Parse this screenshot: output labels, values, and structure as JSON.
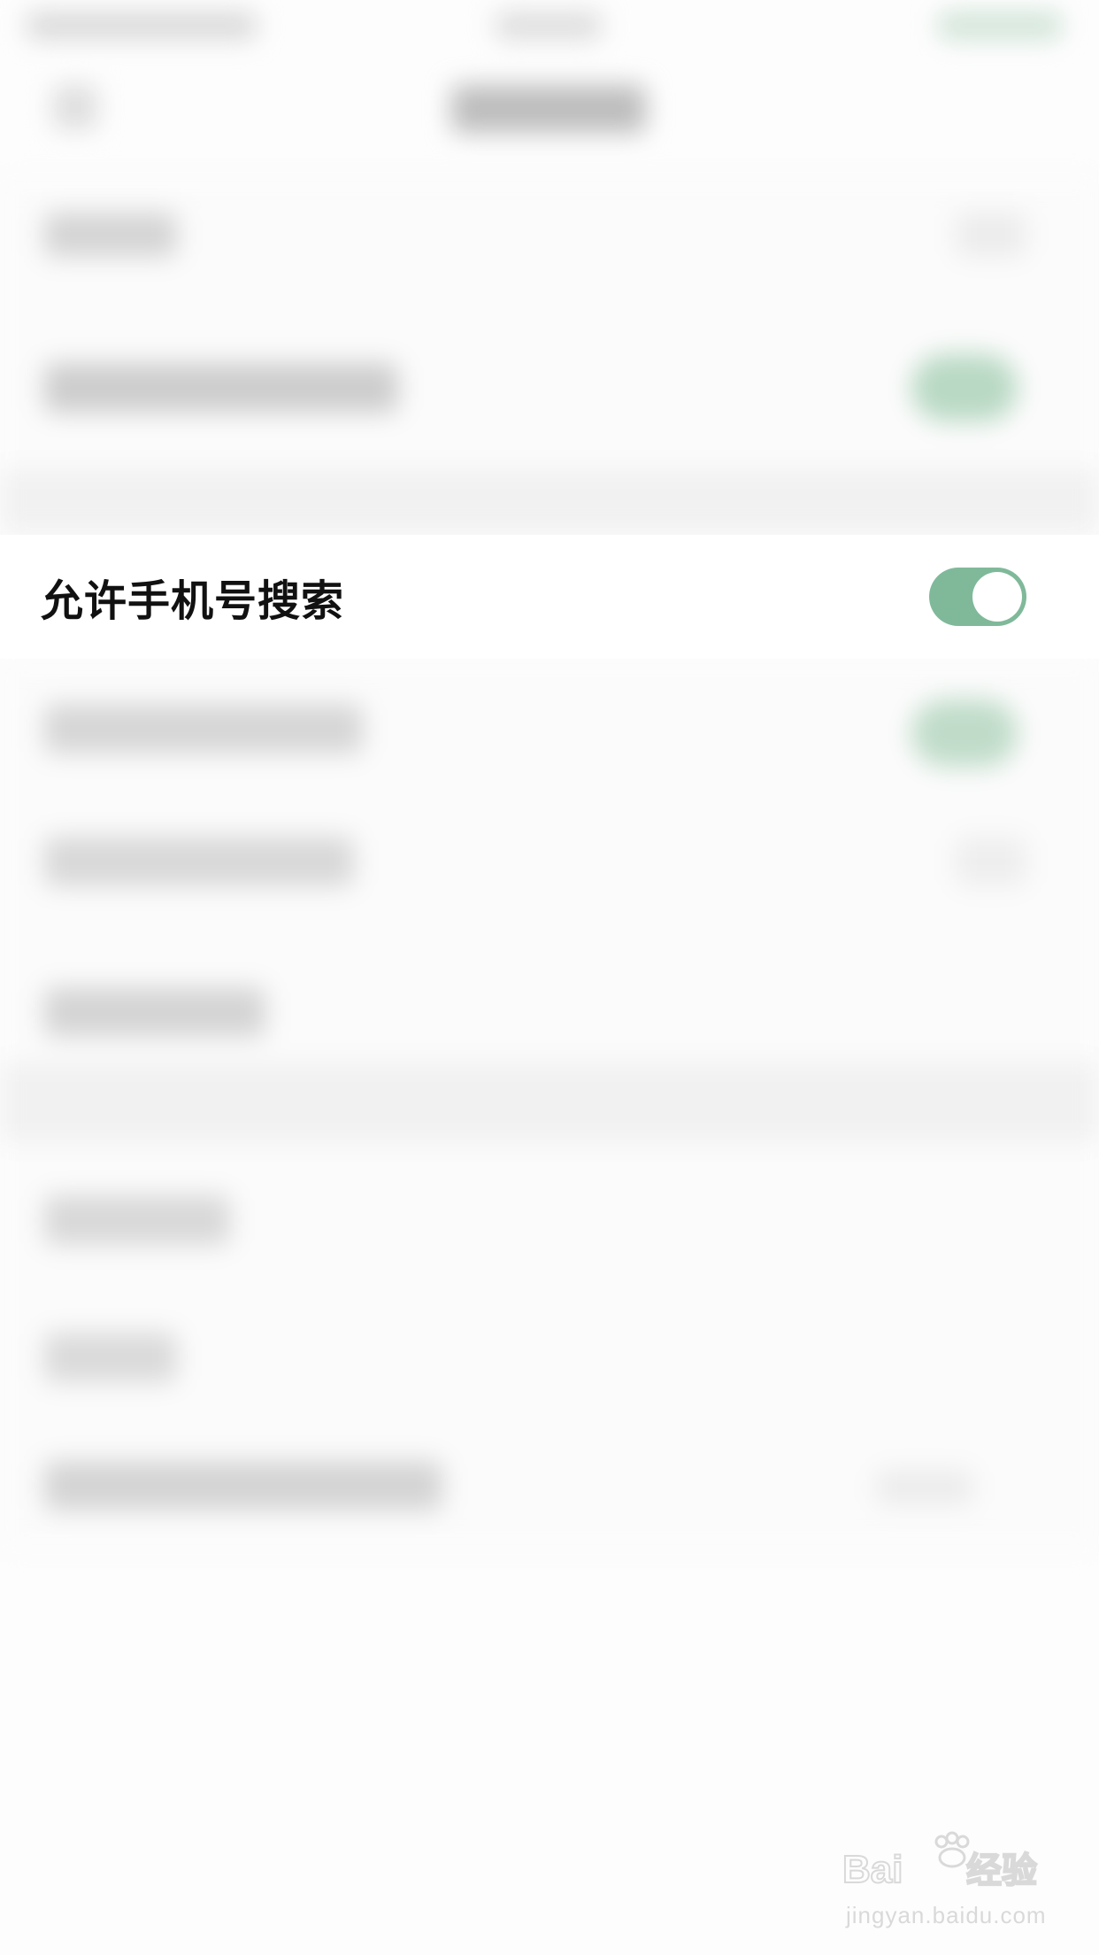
{
  "settings": {
    "focused_item": {
      "label": "允许手机号搜索",
      "toggle_on": true
    }
  },
  "colors": {
    "toggle_on": "#7fb99a",
    "label_text": "#111111",
    "background": "#fdfdfd"
  },
  "icons": {
    "toggle": "toggle-switch-icon",
    "watermark": "baidu-paw-logo"
  },
  "watermark": {
    "logo_text": "Baidu经验",
    "url": "jingyan.baidu.com"
  }
}
